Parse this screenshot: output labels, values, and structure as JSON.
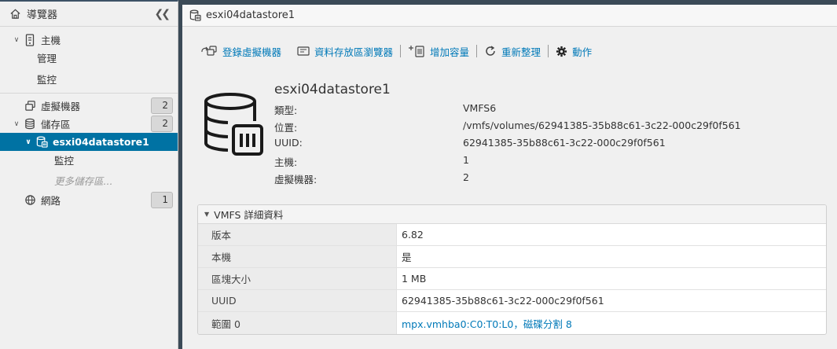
{
  "navigator": {
    "title": "導覽器",
    "items": [
      {
        "label": "主機"
      },
      {
        "label": "管理"
      },
      {
        "label": "監控"
      },
      {
        "label": "虛擬機器",
        "count": "2"
      },
      {
        "label": "儲存區",
        "count": "2"
      },
      {
        "label": "esxi04datastore1"
      },
      {
        "label": "監控"
      },
      {
        "label": "更多儲存區..."
      },
      {
        "label": "網路",
        "count": "1"
      }
    ]
  },
  "main": {
    "title": "esxi04datastore1",
    "toolbar": {
      "register_vm": "登錄虛擬機器",
      "datastore_browser": "資料存放區瀏覽器",
      "increase_capacity": "增加容量",
      "refresh": "重新整理",
      "actions": "動作"
    },
    "datastore": {
      "name": "esxi04datastore1",
      "fields": [
        {
          "label": "類型:",
          "value": "VMFS6"
        },
        {
          "label": "位置:",
          "value": "/vmfs/volumes/62941385-35b88c61-3c22-000c29f0f561"
        },
        {
          "label": "UUID:",
          "value": "62941385-35b88c61-3c22-000c29f0f561"
        },
        {
          "label": "主機:",
          "value": "1"
        },
        {
          "label": "虛擬機器:",
          "value": "2"
        }
      ]
    },
    "vmfs_details": {
      "title": "VMFS 詳細資料",
      "rows": [
        {
          "key": "版本",
          "value": "6.82"
        },
        {
          "key": "本機",
          "value": "是"
        },
        {
          "key": "區塊大小",
          "value": "1 MB"
        },
        {
          "key": "UUID",
          "value": "62941385-35b88c61-3c22-000c29f0f561"
        },
        {
          "key": "範圍 0",
          "value": "mpx.vmhba0:C0:T0:L0，磁碟分割 8"
        }
      ]
    }
  },
  "colors": {
    "accent": "#0072a3",
    "link": "#0079b8",
    "frame": "#3b4a57"
  }
}
